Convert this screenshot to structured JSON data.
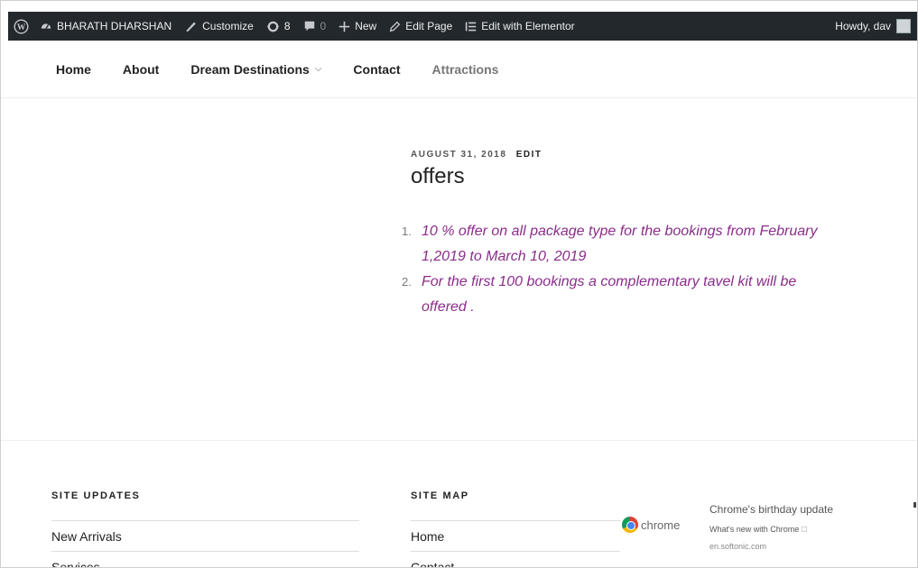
{
  "admin_bar": {
    "site_name": "BHARATH DHARSHAN",
    "customize": "Customize",
    "updates_count": "8",
    "comments_count": "0",
    "new_label": "New",
    "edit_page": "Edit Page",
    "elementor": "Edit with Elementor",
    "howdy": "Howdy, dav"
  },
  "nav": {
    "items": [
      "Home",
      "About",
      "Dream Destinations",
      "Contact",
      "Attractions"
    ]
  },
  "post": {
    "date": "AUGUST 31, 2018",
    "edit": "EDIT",
    "title": "offers",
    "items": [
      {
        "num": "1.",
        "line1": "10 % offer on all package type for the bookings from February",
        "line2": "1,2019  to  March 10, 2019"
      },
      {
        "num": "2.",
        "line1": "For the first 100 bookings a complementary tavel kit will be",
        "line2": "offered ."
      }
    ]
  },
  "footer": {
    "site_updates": {
      "title": "SITE UPDATES",
      "items": [
        "New Arrivals",
        "Services"
      ]
    },
    "site_map": {
      "title": "SITE MAP",
      "items": [
        "Home",
        "Contact"
      ]
    }
  },
  "ad": {
    "brand": "chrome",
    "title": "Chrome's birthday update",
    "subtitle": "What's new with Chrome 🗆",
    "url": "en.softonic.com"
  },
  "colors": {
    "admin_bar_bg": "#23282d",
    "offer_text": "#8a2d8a"
  }
}
